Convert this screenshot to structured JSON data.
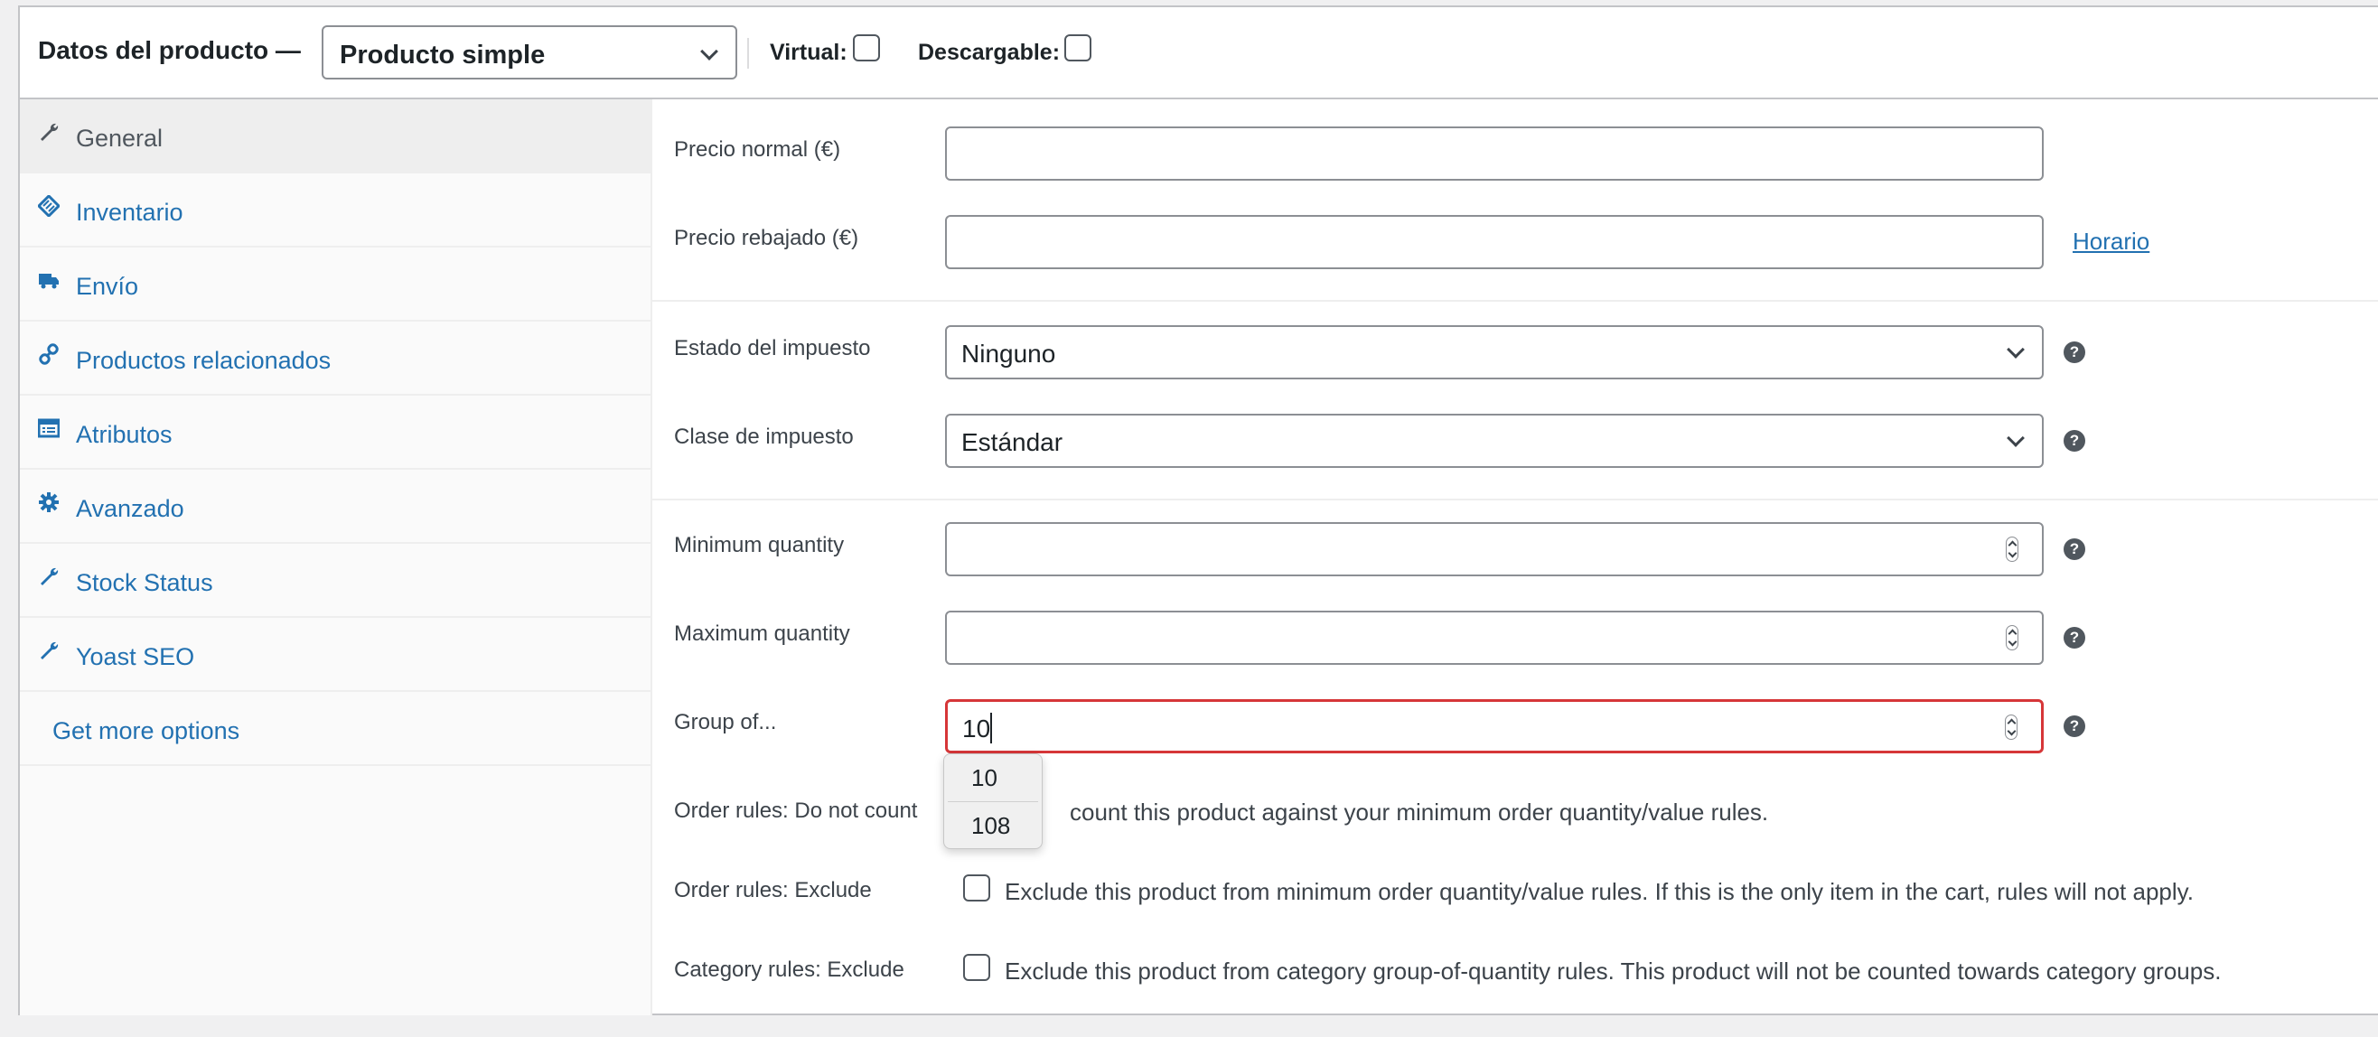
{
  "header": {
    "title": "Datos del producto —",
    "product_type": "Producto simple",
    "virtual_label": "Virtual:",
    "downloadable_label": "Descargable:"
  },
  "tabs": [
    {
      "label": "General",
      "icon": "wrench-icon",
      "active": true
    },
    {
      "label": "Inventario",
      "icon": "tag-icon"
    },
    {
      "label": "Envío",
      "icon": "truck-icon"
    },
    {
      "label": "Productos relacionados",
      "icon": "link-icon"
    },
    {
      "label": "Atributos",
      "icon": "list-icon"
    },
    {
      "label": "Avanzado",
      "icon": "gear-icon"
    },
    {
      "label": "Stock Status",
      "icon": "wrench-icon"
    },
    {
      "label": "Yoast SEO",
      "icon": "wrench-icon"
    },
    {
      "label": "Get more options"
    }
  ],
  "fields": {
    "regular_price": {
      "label": "Precio normal (€)",
      "value": ""
    },
    "sale_price": {
      "label": "Precio rebajado (€)",
      "value": "",
      "schedule_link": "Horario"
    },
    "tax_status": {
      "label": "Estado del impuesto",
      "value": "Ninguno"
    },
    "tax_class": {
      "label": "Clase de impuesto",
      "value": "Estándar"
    },
    "min_qty": {
      "label": "Minimum quantity",
      "value": ""
    },
    "max_qty": {
      "label": "Maximum quantity",
      "value": ""
    },
    "group_of": {
      "label": "Group of...",
      "value": "10"
    }
  },
  "autocomplete": {
    "options": [
      "10",
      "108"
    ]
  },
  "rules": {
    "order_do_not_count": {
      "label": "Order rules: Do not count",
      "text": "count this product against your minimum order quantity/value rules."
    },
    "order_exclude": {
      "label": "Order rules: Exclude",
      "text": "Exclude this product from minimum order quantity/value rules. If this is the only item in the cart, rules will not apply."
    },
    "category_exclude": {
      "label": "Category rules: Exclude",
      "text": "Exclude this product from category group-of-quantity rules. This product will not be counted towards category groups."
    }
  },
  "help_icon": "?",
  "colors": {
    "link": "#2271b1",
    "focus_border": "#d63638",
    "active_tab_bg": "#eeeeee"
  }
}
